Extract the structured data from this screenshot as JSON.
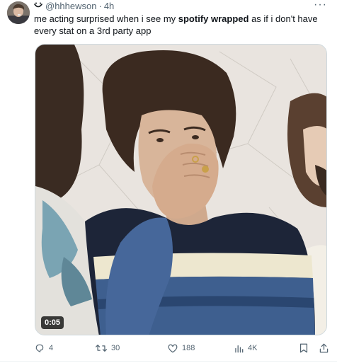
{
  "post": {
    "handle": "@hhhewson",
    "separator": "·",
    "time": "4h",
    "text_before": "me acting surprised when i see my ",
    "text_bold": "spotify wrapped",
    "text_after": " as if i don't have every stat on a 3rd party app"
  },
  "media": {
    "duration": "0:05"
  },
  "actions": {
    "replies": "4",
    "reposts": "30",
    "likes": "188",
    "views": "4K"
  },
  "colors": {
    "text": "#0f1419",
    "muted": "#536471",
    "border": "#cfd9de"
  },
  "icons": [
    "smile-icon",
    "more-icon",
    "reply-icon",
    "repost-icon",
    "like-icon",
    "views-icon",
    "bookmark-icon",
    "share-icon"
  ]
}
